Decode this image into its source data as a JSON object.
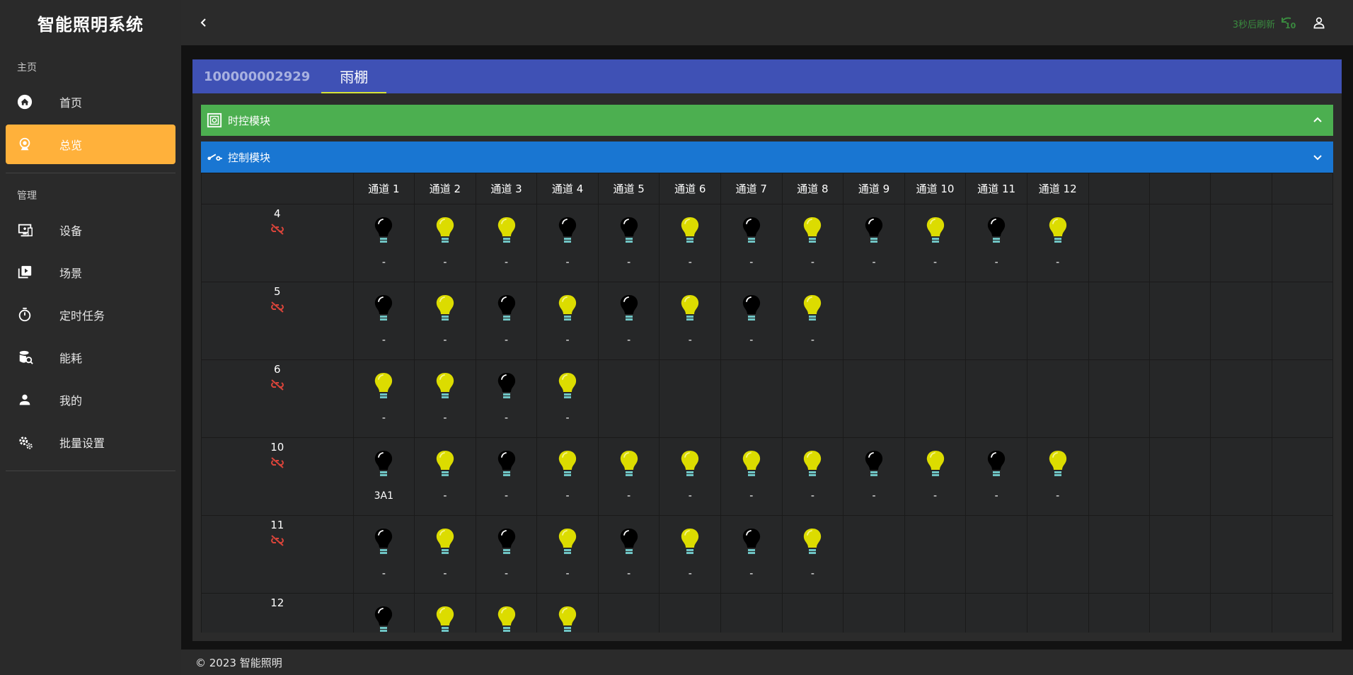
{
  "app": {
    "title": "智能照明系统"
  },
  "sidebar": {
    "section_main": "主页",
    "section_manage": "管理",
    "items": [
      {
        "label": "首页",
        "icon": "home-icon",
        "active": false
      },
      {
        "label": "总览",
        "icon": "webcam-icon",
        "active": true
      },
      {
        "label": "设备",
        "icon": "device-icon",
        "active": false
      },
      {
        "label": "场景",
        "icon": "scene-icon",
        "active": false
      },
      {
        "label": "定时任务",
        "icon": "timer-icon",
        "active": false
      },
      {
        "label": "能耗",
        "icon": "energy-icon",
        "active": false
      },
      {
        "label": "我的",
        "icon": "user-icon",
        "active": false
      },
      {
        "label": "批量设置",
        "icon": "settings-icon",
        "active": false
      }
    ]
  },
  "topbar": {
    "refresh_text": "3秒后刷新",
    "refresh_counter": "10"
  },
  "tabs": {
    "device_id": "100000002929",
    "location": "雨棚"
  },
  "modules": {
    "time_module": "时控模块",
    "control_module": "控制模块"
  },
  "colors": {
    "accent_active": "#ffb13b",
    "tab_bar": "#3f51b5",
    "time_module": "#4caf50",
    "control_module": "#1976d2",
    "bulb_on": "#dcdc00",
    "bulb_off": "#000000",
    "unlink": "#d9443a"
  },
  "grid": {
    "channels": [
      "通道 1",
      "通道 2",
      "通道 3",
      "通道 4",
      "通道 5",
      "通道 6",
      "通道 7",
      "通道 8",
      "通道 9",
      "通道 10",
      "通道 11",
      "通道 12"
    ],
    "rows": [
      {
        "id": "4",
        "states": [
          0,
          1,
          1,
          0,
          0,
          1,
          0,
          1,
          0,
          1,
          0,
          1
        ],
        "values": [
          "-",
          "-",
          "-",
          "-",
          "-",
          "-",
          "-",
          "-",
          "-",
          "-",
          "-",
          "-"
        ]
      },
      {
        "id": "5",
        "states": [
          0,
          1,
          0,
          1,
          0,
          1,
          0,
          1
        ],
        "values": [
          "-",
          "-",
          "-",
          "-",
          "-",
          "-",
          "-",
          "-"
        ]
      },
      {
        "id": "6",
        "states": [
          1,
          1,
          0,
          1
        ],
        "values": [
          "-",
          "-",
          "-",
          "-"
        ]
      },
      {
        "id": "10",
        "states": [
          0,
          1,
          0,
          1,
          1,
          1,
          1,
          1,
          0,
          1,
          0,
          1
        ],
        "values": [
          "3A1",
          "-",
          "-",
          "-",
          "-",
          "-",
          "-",
          "-",
          "-",
          "-",
          "-",
          "-"
        ]
      },
      {
        "id": "11",
        "states": [
          0,
          1,
          0,
          1,
          0,
          1,
          0,
          1
        ],
        "values": [
          "-",
          "-",
          "-",
          "-",
          "-",
          "-",
          "-",
          "-"
        ]
      },
      {
        "id": "12",
        "states": [
          0,
          1,
          1,
          1
        ],
        "values": [
          "",
          "",
          "",
          ""
        ]
      }
    ]
  },
  "footer": {
    "text": "© 2023 智能照明"
  }
}
